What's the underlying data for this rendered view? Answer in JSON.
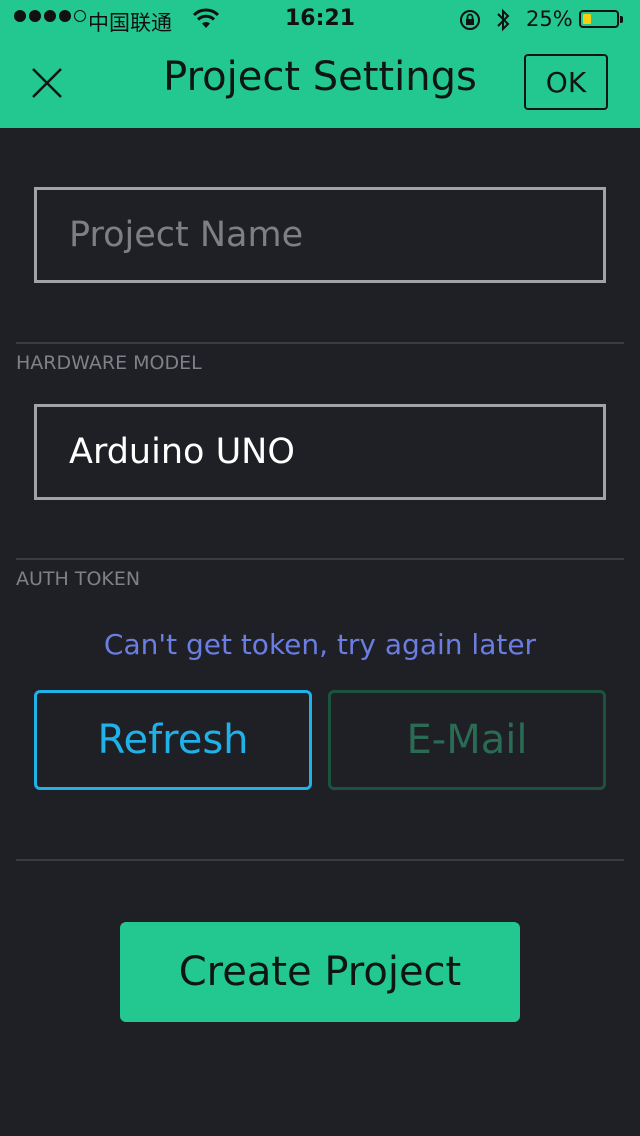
{
  "status_bar": {
    "carrier": "中国联通",
    "time": "16:21",
    "battery_percent": "25%",
    "battery_level": 0.25
  },
  "header": {
    "title": "Project Settings",
    "ok_label": "OK",
    "close_icon": "close-icon"
  },
  "form": {
    "project_name_placeholder": "Project Name",
    "project_name_value": "",
    "hardware_label": "HARDWARE MODEL",
    "hardware_value": "Arduino UNO",
    "auth_label": "AUTH TOKEN",
    "token_message": "Can't get token, try again later",
    "refresh_label": "Refresh",
    "email_label": "E-Mail",
    "create_label": "Create Project"
  },
  "colors": {
    "accent": "#23c890",
    "background": "#1f2025",
    "refresh": "#1fb1e8",
    "email_disabled": "#2b6a53",
    "token_message": "#6b7de0"
  }
}
